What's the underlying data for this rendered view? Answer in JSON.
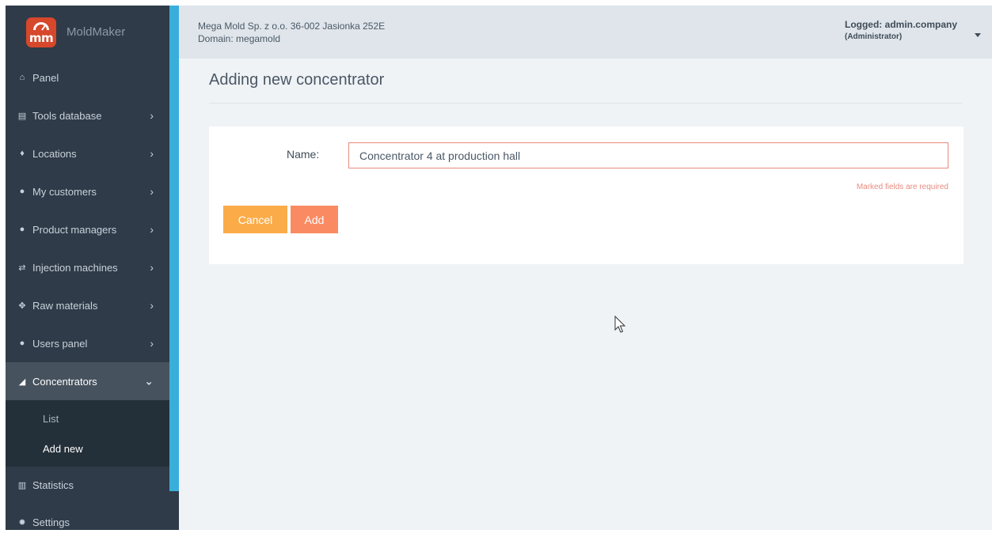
{
  "app": {
    "brand": "MoldMaker",
    "logo_text": "mm"
  },
  "header": {
    "company_line": "Mega Mold Sp. z o.o. 36-002 Jasionka 252E",
    "domain_line": "Domain: megamold",
    "logged_label": "Logged: admin.company",
    "role_label": "(Administrator)"
  },
  "sidebar": {
    "items": [
      {
        "label": "Panel",
        "icon": "home-icon",
        "glyph": "⌂",
        "chevron": ""
      },
      {
        "label": "Tools database",
        "icon": "database-icon",
        "glyph": "▤",
        "chevron": "›"
      },
      {
        "label": "Locations",
        "icon": "map-marker-icon",
        "glyph": "♦",
        "chevron": "›"
      },
      {
        "label": "My customers",
        "icon": "user-icon",
        "glyph": "●",
        "chevron": "›"
      },
      {
        "label": "Product managers",
        "icon": "users-icon",
        "glyph": "●",
        "chevron": "›"
      },
      {
        "label": "Injection machines",
        "icon": "exchange-icon",
        "glyph": "⇄",
        "chevron": "›"
      },
      {
        "label": "Raw materials",
        "icon": "move-icon",
        "glyph": "✥",
        "chevron": "›"
      },
      {
        "label": "Users panel",
        "icon": "user-icon",
        "glyph": "●",
        "chevron": "›"
      },
      {
        "label": "Concentrators",
        "icon": "rss-icon",
        "glyph": "◢",
        "chevron": "⌄"
      }
    ],
    "sub_items": [
      {
        "label": "List"
      },
      {
        "label": "Add new"
      }
    ],
    "bottom_items": [
      {
        "label": "Statistics",
        "icon": "bar-chart-icon",
        "glyph": "▥"
      },
      {
        "label": "Settings",
        "icon": "gear-icon",
        "glyph": "✹"
      }
    ]
  },
  "main": {
    "title": "Adding new concentrator",
    "form": {
      "name_label": "Name:",
      "name_value": "Concentrator 4 at production hall",
      "required_note": "Marked fields are required",
      "cancel_label": "Cancel",
      "add_label": "Add"
    }
  },
  "colors": {
    "sidebar_bg": "#2f3b48",
    "accent": "#3aaedb",
    "cancel": "#fbac49",
    "add": "#fa8a62",
    "error": "#e98b80"
  }
}
